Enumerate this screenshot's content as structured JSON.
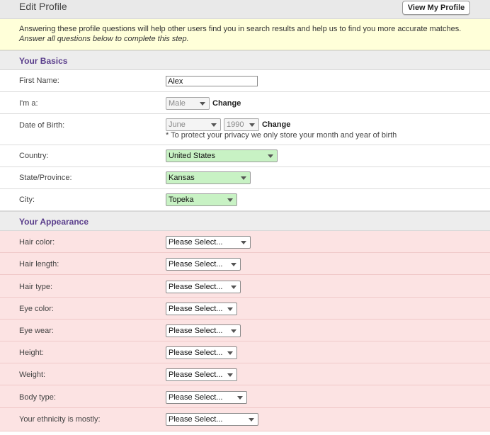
{
  "header": {
    "title": "Edit Profile",
    "view_profile_label": "View My Profile"
  },
  "intro": {
    "line1": "Answering these profile questions will help other users find you in search results and help us to find you more accurate matches.",
    "line2": "Answer all questions below to complete this step."
  },
  "basics": {
    "heading": "Your Basics",
    "first_name": {
      "label": "First Name:",
      "value": "Alex"
    },
    "gender": {
      "label": "I'm a:",
      "value": "Male",
      "change": "Change"
    },
    "dob": {
      "label": "Date of Birth:",
      "month": "June",
      "year": "1990",
      "change": "Change",
      "note": "* To protect your privacy we only store your month and year of birth"
    },
    "country": {
      "label": "Country:",
      "value": "United States"
    },
    "state": {
      "label": "State/Province:",
      "value": "Kansas"
    },
    "city": {
      "label": "City:",
      "value": "Topeka"
    }
  },
  "appearance": {
    "heading": "Your Appearance",
    "placeholder": "Please Select...",
    "fields": [
      {
        "label": "Hair color:"
      },
      {
        "label": "Hair length:"
      },
      {
        "label": "Hair type:"
      },
      {
        "label": "Eye color:"
      },
      {
        "label": "Eye wear:"
      },
      {
        "label": "Height:"
      },
      {
        "label": "Weight:"
      },
      {
        "label": "Body type:"
      },
      {
        "label": "Your ethnicity is mostly:"
      }
    ]
  },
  "colors": {
    "section_heading": "#5a3e8c",
    "valid_select": "#c8f2c4",
    "incomplete_row": "#fce3e3",
    "intro_bg": "#ffffd9"
  }
}
